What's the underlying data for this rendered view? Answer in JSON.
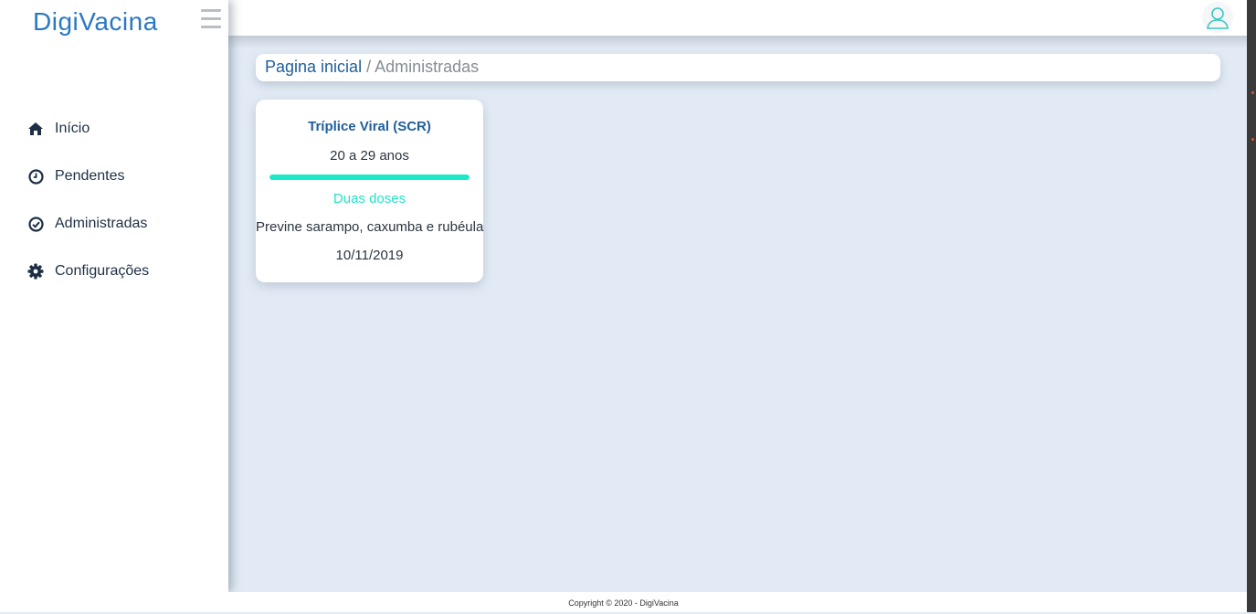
{
  "app": {
    "logo_text": "DigiVacina",
    "accent_color": "#2a78c4",
    "progress_color": "#1de9c8"
  },
  "sidebar": {
    "items": [
      {
        "label": "Início",
        "icon": "home-icon"
      },
      {
        "label": "Pendentes",
        "icon": "clock-icon"
      },
      {
        "label": "Administradas",
        "icon": "check-circle-icon"
      },
      {
        "label": "Configurações",
        "icon": "gear-icon"
      }
    ]
  },
  "header": {
    "user_icon": "user-icon"
  },
  "breadcrumb": {
    "home": "Pagina inicial",
    "separator": "/",
    "current": "Administradas"
  },
  "vaccine_card": {
    "name": "Tríplice Viral (SCR)",
    "age_range": "20 a 29 anos",
    "progress_fraction": 1.0,
    "doses": "Duas doses",
    "description": "Previne sarampo, caxumba e rubéula",
    "date": "10/11/2019"
  },
  "footer": {
    "copyright": "Copyright © 2020 - DigiVacina"
  }
}
